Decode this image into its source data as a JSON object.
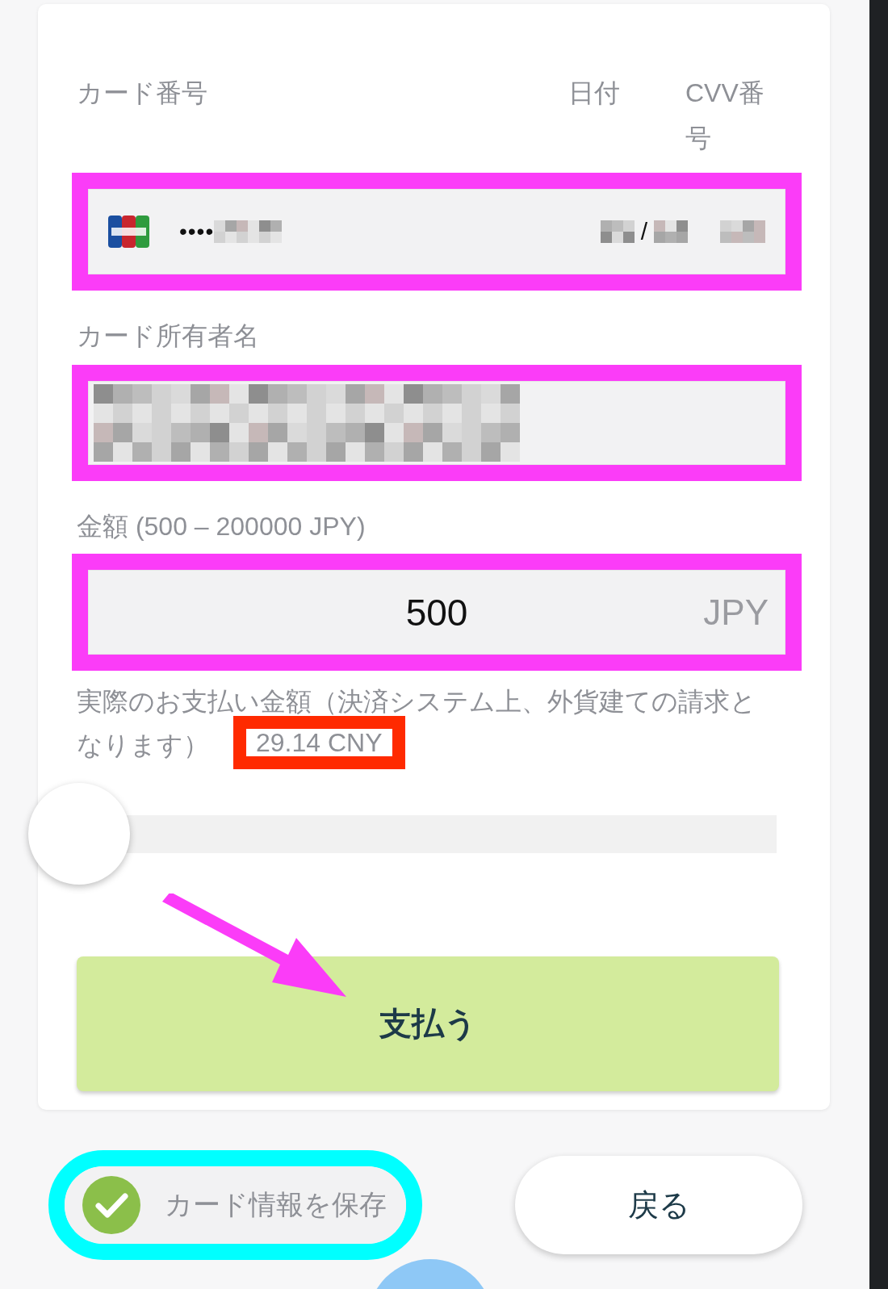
{
  "card_form": {
    "labels": {
      "card_number": "カード番号",
      "date": "日付",
      "cvv": "CVV番号"
    },
    "card_number": {
      "masked": "••••",
      "date_separator": "/"
    },
    "holder_label": "カード所有者名",
    "amount_label": "金額 (500 – 200000 JPY)",
    "amount": {
      "value": "500",
      "currency": "JPY"
    },
    "note": "実際のお支払い金額（決済システム上、外貨建ての請求となります）",
    "converted": "29.14 CNY",
    "slider": {
      "level": 0
    },
    "pay_button": "支払う"
  },
  "save_card": {
    "label": "カード情報を保存",
    "checked": true
  },
  "back_button": "戻る"
}
